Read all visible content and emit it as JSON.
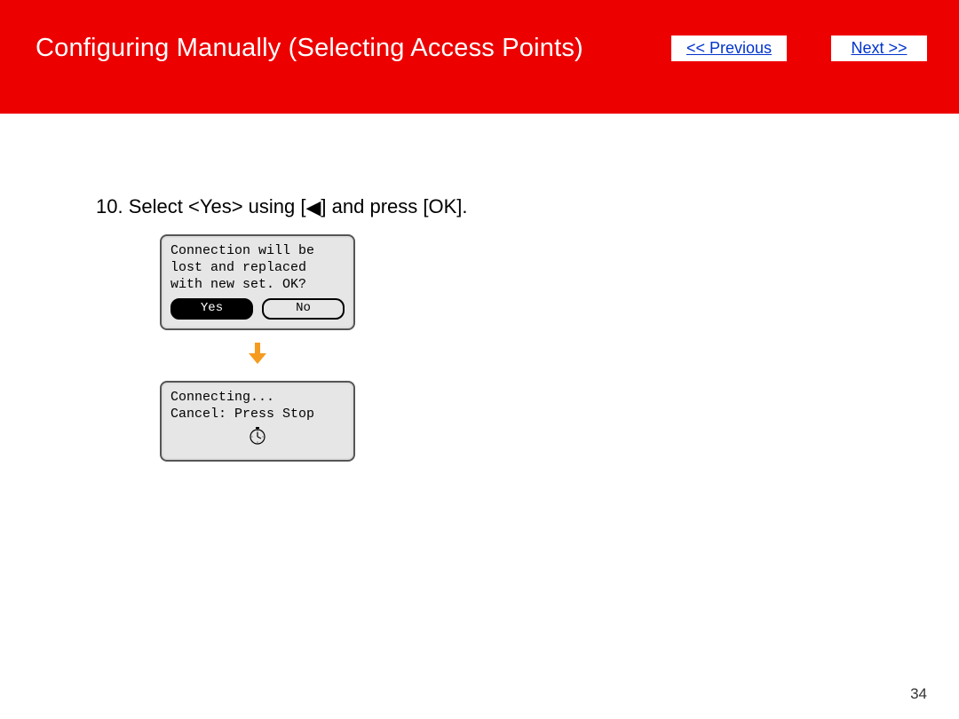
{
  "header": {
    "title": "Configuring Manually (Selecting Access Points)",
    "prev_label": "<< Previous",
    "next_label": "Next >>"
  },
  "step": {
    "number": "10.",
    "text_before": "Select <Yes> using [",
    "arrow_glyph": "◀",
    "text_after": "] and press [OK]."
  },
  "lcd1": {
    "line1": "Connection will be",
    "line2": "lost and replaced",
    "line3": "with new set. OK?",
    "yes": "Yes",
    "no": "No"
  },
  "lcd2": {
    "line1": "Connecting...",
    "line2": "Cancel: Press Stop"
  },
  "page_number": "34"
}
